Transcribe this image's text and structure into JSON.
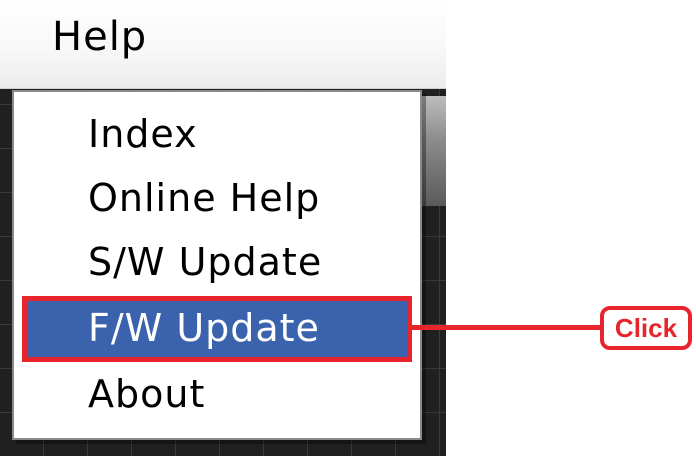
{
  "menubar": {
    "help_label": "Help"
  },
  "help_menu": {
    "items": [
      {
        "label": "Index"
      },
      {
        "label": "Online Help"
      },
      {
        "label": "S/W Update"
      },
      {
        "label": "F/W Update",
        "selected": true
      },
      {
        "label": "About"
      }
    ]
  },
  "annotation": {
    "callout_label": "Click",
    "color": "#e8242c"
  },
  "colors": {
    "selection": "#3b63ad",
    "selection_text": "#ffffff"
  }
}
